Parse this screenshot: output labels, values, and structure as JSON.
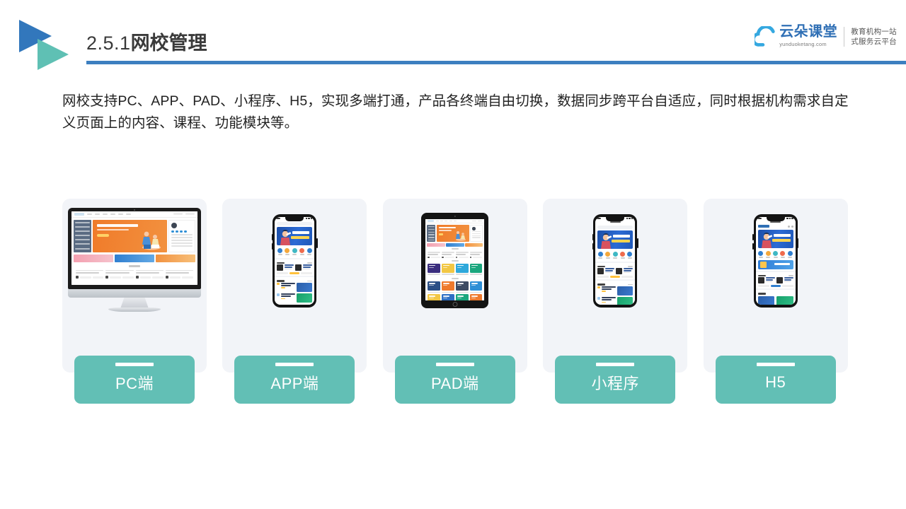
{
  "slide": {
    "title_number": "2.5.1",
    "title_text": "网校管理",
    "body_text": "网校支持PC、APP、PAD、小程序、H5，实现多端打通，产品各终端自由切换，数据同步跨平台自适应，同时根据机构需求自定义页面上的内容、课程、功能模块等。"
  },
  "brand": {
    "name_cn": "云朵课堂",
    "url": "yunduoketang.com",
    "tagline_line1": "教育机构一站",
    "tagline_line2": "式服务云平台"
  },
  "colors": {
    "accent_blue": "#3C7FC0",
    "logo_blue": "#3277BC",
    "logo_teal": "#5FC0B4",
    "label_teal": "#62BFB5",
    "card_bg": "#F2F4F8",
    "banner_orange": "#F07B2A",
    "banner_blue": "#2C6BD4"
  },
  "cards": [
    {
      "label": "PC端",
      "device": "desktop",
      "icon": "monitor-icon"
    },
    {
      "label": "APP端",
      "device": "phone",
      "icon": "smartphone-icon"
    },
    {
      "label": "PAD端",
      "device": "tablet",
      "icon": "tablet-icon"
    },
    {
      "label": "小程序",
      "device": "phone",
      "icon": "smartphone-icon"
    },
    {
      "label": "H5",
      "device": "phone",
      "icon": "smartphone-icon"
    }
  ]
}
